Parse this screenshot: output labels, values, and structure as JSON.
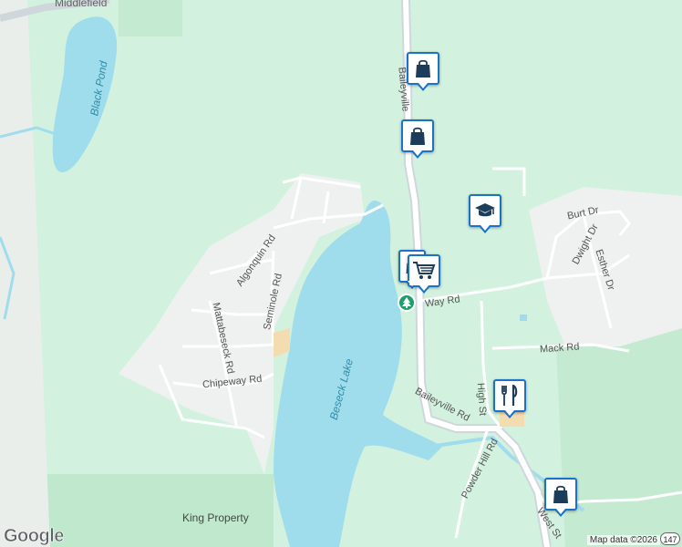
{
  "map": {
    "places": {
      "top_left_place": "Middlefield",
      "water": [
        "Black Pond",
        "Beseck Lake"
      ],
      "park": "King Property"
    },
    "roads": {
      "baileyville_north": "Baileyville",
      "baileyville_south": "Baileyville Rd",
      "burt": "Burt Dr",
      "dwight": "Dwight Dr",
      "esther": "Esther Dr",
      "way": "Way Rd",
      "mack": "Mack Rd",
      "high": "High St",
      "powder_hill": "Powder Hill Rd",
      "west": "West St",
      "algonquin": "Algonquin Rd",
      "seminole": "Seminole Rd",
      "mattabeseck": "Mattabeseck Rd",
      "chipeway": "Chipeway Rd",
      "route_shield": "147"
    },
    "pois": [
      {
        "icon": "shopping-bag-icon",
        "kind": "shopping"
      },
      {
        "icon": "shopping-bag-icon",
        "kind": "shopping"
      },
      {
        "icon": "graduation-cap-icon",
        "kind": "school"
      },
      {
        "icon": "shopping-cart-icon",
        "kind": "grocery"
      },
      {
        "icon": "fork-knife-icon",
        "kind": "restaurant"
      },
      {
        "icon": "shopping-bag-icon",
        "kind": "shopping"
      },
      {
        "icon": "tree-icon",
        "kind": "park"
      }
    ],
    "colors": {
      "land": "#d2f2df",
      "water": "#9fdcec",
      "developed": "#eef1ef",
      "park_dark": "#bfe8cc",
      "road": "#cfd6dc",
      "marker_border": "#1a73c8",
      "marker_icon": "#1c3d5a"
    },
    "logo": "Google",
    "attribution": "Map data ©2026"
  }
}
